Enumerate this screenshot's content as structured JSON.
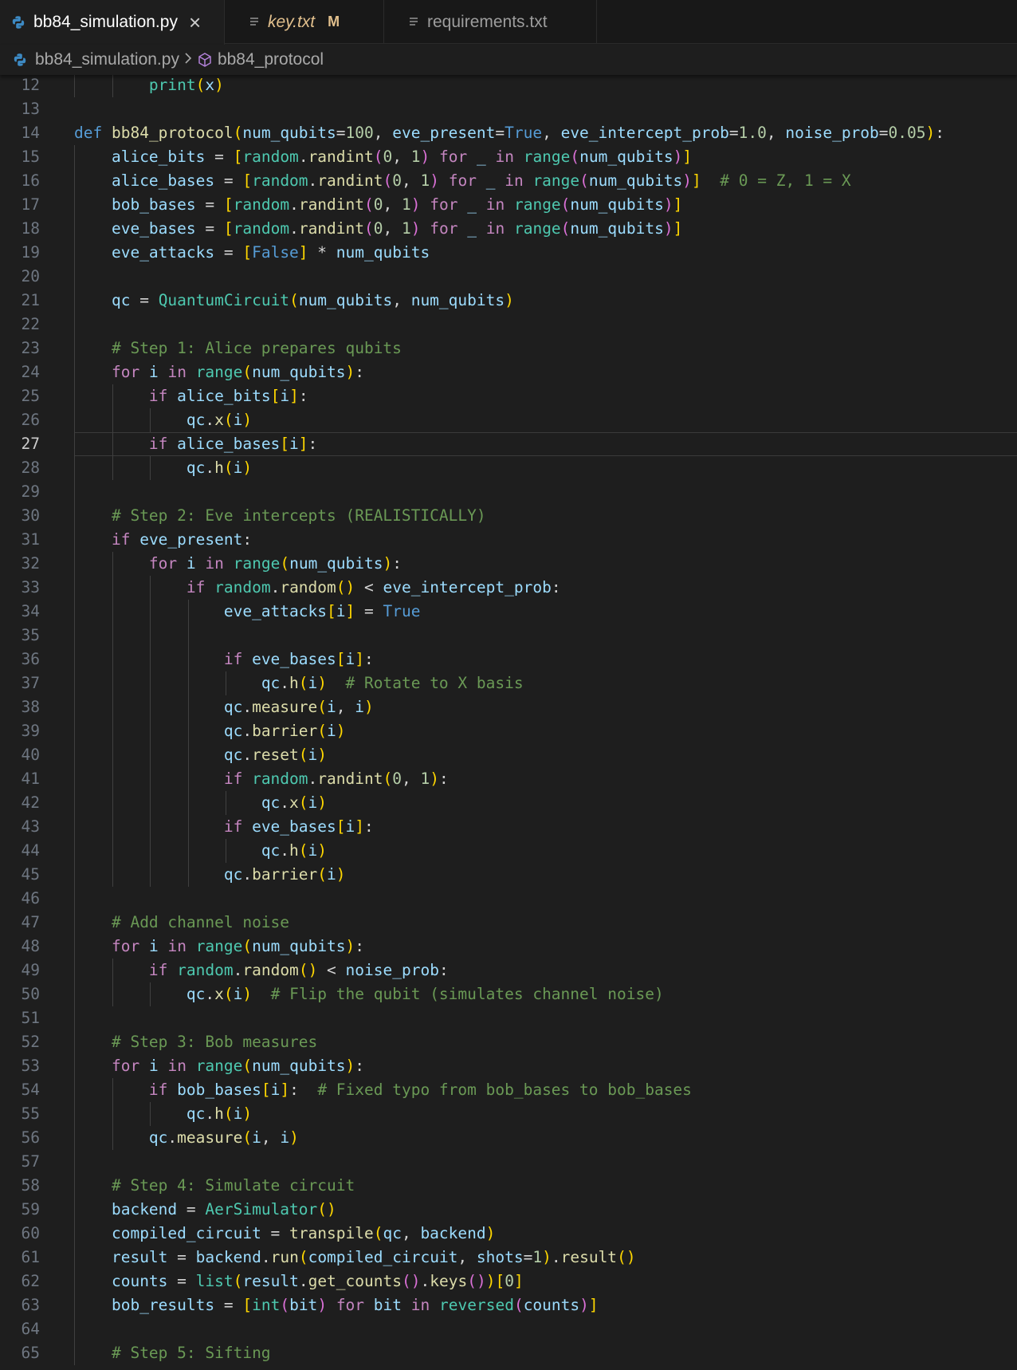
{
  "tabs": [
    {
      "label": "bb84_simulation.py",
      "active": true,
      "icon": "python-icon",
      "close": "×"
    },
    {
      "label": "key.txt",
      "modified": "M",
      "icon": "lines-icon"
    },
    {
      "label": "requirements.txt",
      "icon": "lines-icon"
    }
  ],
  "breadcrumb": {
    "file": "bb84_simulation.py",
    "symbol": "bb84_protocol"
  },
  "editor": {
    "current_line": 27,
    "lines": [
      {
        "n": "12",
        "code": "        print(x)"
      },
      {
        "n": "13",
        "code": ""
      },
      {
        "n": "14",
        "code": "def bb84_protocol(num_qubits=100, eve_present=True, eve_intercept_prob=1.0, noise_prob=0.05):"
      },
      {
        "n": "15",
        "code": "    alice_bits = [random.randint(0, 1) for _ in range(num_qubits)]"
      },
      {
        "n": "16",
        "code": "    alice_bases = [random.randint(0, 1) for _ in range(num_qubits)]  # 0 = Z, 1 = X"
      },
      {
        "n": "17",
        "code": "    bob_bases = [random.randint(0, 1) for _ in range(num_qubits)]"
      },
      {
        "n": "18",
        "code": "    eve_bases = [random.randint(0, 1) for _ in range(num_qubits)]"
      },
      {
        "n": "19",
        "code": "    eve_attacks = [False] * num_qubits"
      },
      {
        "n": "20",
        "code": ""
      },
      {
        "n": "21",
        "code": "    qc = QuantumCircuit(num_qubits, num_qubits)"
      },
      {
        "n": "22",
        "code": ""
      },
      {
        "n": "23",
        "code": "    # Step 1: Alice prepares qubits"
      },
      {
        "n": "24",
        "code": "    for i in range(num_qubits):"
      },
      {
        "n": "25",
        "code": "        if alice_bits[i]:"
      },
      {
        "n": "26",
        "code": "            qc.x(i)"
      },
      {
        "n": "27",
        "code": "        if alice_bases[i]:"
      },
      {
        "n": "28",
        "code": "            qc.h(i)"
      },
      {
        "n": "29",
        "code": ""
      },
      {
        "n": "30",
        "code": "    # Step 2: Eve intercepts (REALISTICALLY)"
      },
      {
        "n": "31",
        "code": "    if eve_present:"
      },
      {
        "n": "32",
        "code": "        for i in range(num_qubits):"
      },
      {
        "n": "33",
        "code": "            if random.random() < eve_intercept_prob:"
      },
      {
        "n": "34",
        "code": "                eve_attacks[i] = True"
      },
      {
        "n": "35",
        "code": ""
      },
      {
        "n": "36",
        "code": "                if eve_bases[i]:"
      },
      {
        "n": "37",
        "code": "                    qc.h(i)  # Rotate to X basis"
      },
      {
        "n": "38",
        "code": "                qc.measure(i, i)"
      },
      {
        "n": "39",
        "code": "                qc.barrier(i)"
      },
      {
        "n": "40",
        "code": "                qc.reset(i)"
      },
      {
        "n": "41",
        "code": "                if random.randint(0, 1):"
      },
      {
        "n": "42",
        "code": "                    qc.x(i)"
      },
      {
        "n": "43",
        "code": "                if eve_bases[i]:"
      },
      {
        "n": "44",
        "code": "                    qc.h(i)"
      },
      {
        "n": "45",
        "code": "                qc.barrier(i)"
      },
      {
        "n": "46",
        "code": ""
      },
      {
        "n": "47",
        "code": "    # Add channel noise"
      },
      {
        "n": "48",
        "code": "    for i in range(num_qubits):"
      },
      {
        "n": "49",
        "code": "        if random.random() < noise_prob:"
      },
      {
        "n": "50",
        "code": "            qc.x(i)  # Flip the qubit (simulates channel noise)"
      },
      {
        "n": "51",
        "code": ""
      },
      {
        "n": "52",
        "code": "    # Step 3: Bob measures"
      },
      {
        "n": "53",
        "code": "    for i in range(num_qubits):"
      },
      {
        "n": "54",
        "code": "        if bob_bases[i]:  # Fixed typo from bob_bases to bob_bases"
      },
      {
        "n": "55",
        "code": "            qc.h(i)"
      },
      {
        "n": "56",
        "code": "        qc.measure(i, i)"
      },
      {
        "n": "57",
        "code": ""
      },
      {
        "n": "58",
        "code": "    # Step 4: Simulate circuit"
      },
      {
        "n": "59",
        "code": "    backend = AerSimulator()"
      },
      {
        "n": "60",
        "code": "    compiled_circuit = transpile(qc, backend)"
      },
      {
        "n": "61",
        "code": "    result = backend.run(compiled_circuit, shots=1).result()"
      },
      {
        "n": "62",
        "code": "    counts = list(result.get_counts().keys())[0]"
      },
      {
        "n": "63",
        "code": "    bob_results = [int(bit) for bit in reversed(counts)]"
      },
      {
        "n": "64",
        "code": ""
      },
      {
        "n": "65",
        "code": "    # Step 5: Sifting"
      }
    ]
  }
}
